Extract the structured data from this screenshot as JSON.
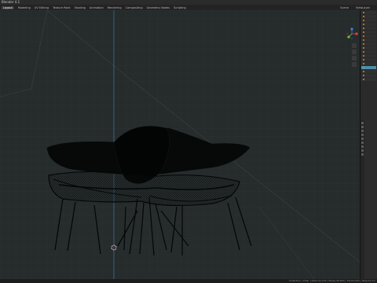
{
  "window": {
    "title": "Blender 4.1"
  },
  "menubar": {
    "items": [
      "Layout",
      "Modeling",
      "UV Editing",
      "Texture Paint",
      "Shading",
      "Animation",
      "Rendering",
      "Compositing",
      "Geometry Nodes",
      "Scripting"
    ],
    "active_index": 0,
    "right": [
      "Scene",
      "ViewLayer"
    ]
  },
  "viewport": {
    "shading": "Wireframe",
    "object": "Chair",
    "colors": {
      "background": "#262c2c",
      "grid": "#2f3636",
      "axis_z": "#3b6fa0",
      "mesh": "#050707"
    }
  },
  "gizmo": {
    "x_color": "#e0453f",
    "y_color": "#7bbf3a",
    "z_color": "#3f7fe0"
  },
  "outliner": {
    "rows": 18,
    "selected_row": 14
  },
  "statusbar": {
    "text": "Collection | Chair | Verts:31,274 | Faces:30,810 | Tris:61,620 | Objects:1/1"
  }
}
